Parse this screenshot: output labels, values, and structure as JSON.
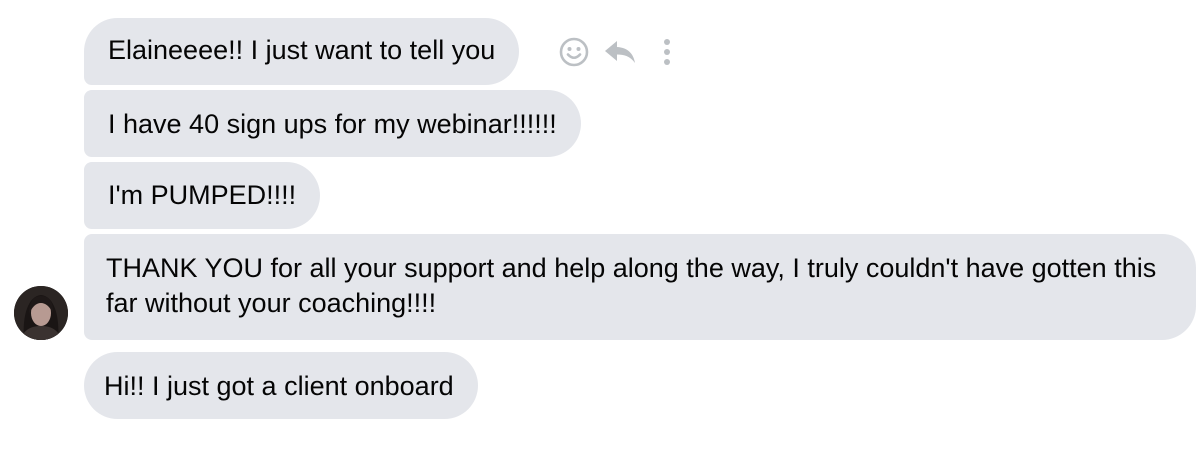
{
  "conversation": {
    "messages": [
      {
        "text": "Elaineeee!! I just want to tell you"
      },
      {
        "text": "I have 40 sign ups for my webinar!!!!!!"
      },
      {
        "text": "I'm PUMPED!!!!"
      },
      {
        "text": "THANK YOU for all your support and help along the way, I truly couldn't have gotten this far without your coaching!!!!"
      },
      {
        "text": "Hi!! I just got a client onboard"
      }
    ]
  },
  "message_actions": {
    "icons": [
      "smiley-face-icon",
      "reply-arrow-icon",
      "vertical-ellipsis-icon"
    ],
    "icon_color": "#bcc0c4"
  },
  "colors": {
    "bubble_background": "#e4e6eb",
    "text": "#050505",
    "page_background": "#ffffff"
  }
}
